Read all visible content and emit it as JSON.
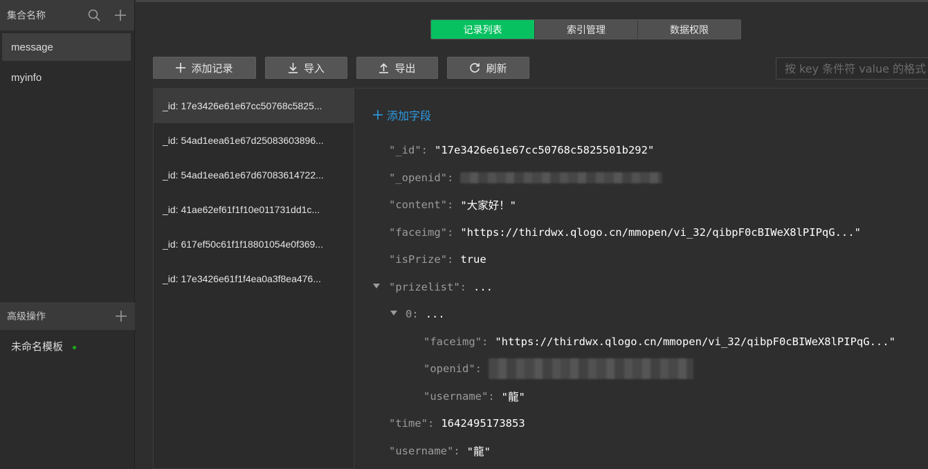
{
  "sidebar": {
    "header_title": "集合名称",
    "collections": [
      {
        "label": "message",
        "active": true
      },
      {
        "label": "myinfo",
        "active": false
      }
    ],
    "advanced_title": "高级操作",
    "template_label": "未命名模板"
  },
  "tabs": [
    {
      "label": "记录列表",
      "active": true
    },
    {
      "label": "索引管理",
      "active": false
    },
    {
      "label": "数据权限",
      "active": false
    }
  ],
  "toolbar": {
    "add_label": "添加记录",
    "import_label": "导入",
    "export_label": "导出",
    "refresh_label": "刷新"
  },
  "filter": {
    "placeholder": "按 key 条件符 value 的格式搜"
  },
  "records": [
    "_id: 17e3426e61e67cc50768c5825...",
    "_id: 54ad1eea61e67d25083603896...",
    "_id: 54ad1eea61e67d67083614722...",
    "_id: 41ae62ef61f1f10e011731dd1c...",
    "_id: 617ef50c61f1f18801054e0f369...",
    "_id: 17e3426e61f1f4ea0a3f8ea476..."
  ],
  "detail": {
    "add_field_label": "添加字段",
    "id_key": "\"_id\"",
    "id_val": "\"17e3426e61e67cc50768c5825501b292\"",
    "openid_key": "\"_openid\"",
    "content_key": "\"content\"",
    "content_val": "\"大家好！\"",
    "faceimg_key": "\"faceimg\"",
    "faceimg_val": "\"https://thirdwx.qlogo.cn/mmopen/vi_32/qibpF0cBIWeX8lPIPqG...\"",
    "isprize_key": "\"isPrize\"",
    "isprize_val": "true",
    "prizelist_key": "\"prizelist\"",
    "prizelist_val": "...",
    "item0_key": "0",
    "item0_val": "...",
    "p_faceimg_key": "\"faceimg\"",
    "p_faceimg_val": "\"https://thirdwx.qlogo.cn/mmopen/vi_32/qibpF0cBIWeX8lPIPqG...\"",
    "p_openid_key": "\"openid\"",
    "p_username_key": "\"username\"",
    "p_username_val": "\"龍\"",
    "time_key": "\"time\"",
    "time_val": "1642495173853",
    "username_key": "\"username\"",
    "username_val": "\"龍\""
  },
  "colors": {
    "accent": "#07c160",
    "link": "#2d9ce6",
    "background": "#2e2e2e"
  }
}
